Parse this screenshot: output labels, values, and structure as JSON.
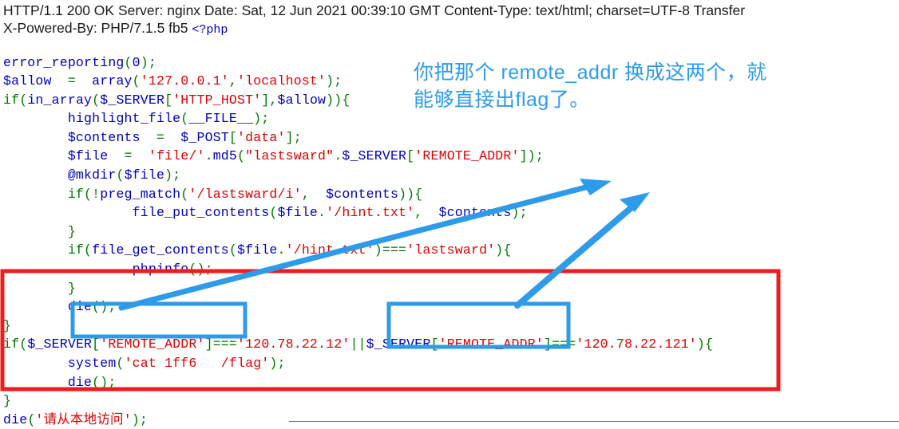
{
  "http_response": {
    "line1": "HTTP/1.1 200 OK Server: nginx Date: Sat, 12 Jun 2021 00:39:10 GMT Content-Type: text/html; charset=UTF-8 Transfer",
    "line2_prefix": "X-Powered-By: PHP/7.1.5 fb5 ",
    "php_open_tag": "<?php"
  },
  "code": {
    "lines": [
      [
        {
          "t": "error_reporting",
          "c": "fn"
        },
        {
          "t": "(",
          "c": "kw"
        },
        {
          "t": "0",
          "c": "fn"
        },
        {
          "t": ");",
          "c": "kw"
        }
      ],
      [
        {
          "t": "$allow",
          "c": "fn"
        },
        {
          "t": "  =  ",
          "c": "kw"
        },
        {
          "t": "array",
          "c": "fn"
        },
        {
          "t": "(",
          "c": "kw"
        },
        {
          "t": "'127.0.0.1'",
          "c": "str"
        },
        {
          "t": ",",
          "c": "kw"
        },
        {
          "t": "'localhost'",
          "c": "str"
        },
        {
          "t": ");",
          "c": "kw"
        }
      ],
      [
        {
          "t": "if",
          "c": "kw"
        },
        {
          "t": "(",
          "c": "kw"
        },
        {
          "t": "in_array",
          "c": "fn"
        },
        {
          "t": "(",
          "c": "kw"
        },
        {
          "t": "$_SERVER",
          "c": "fn"
        },
        {
          "t": "[",
          "c": "kw"
        },
        {
          "t": "'HTTP_HOST'",
          "c": "str"
        },
        {
          "t": "],",
          "c": "kw"
        },
        {
          "t": "$allow",
          "c": "fn"
        },
        {
          "t": ")){",
          "c": "kw"
        }
      ],
      [
        {
          "t": "        ",
          "c": "kw"
        },
        {
          "t": "highlight_file",
          "c": "fn"
        },
        {
          "t": "(",
          "c": "kw"
        },
        {
          "t": "__FILE__",
          "c": "fn"
        },
        {
          "t": ");",
          "c": "kw"
        }
      ],
      [
        {
          "t": "        ",
          "c": "kw"
        },
        {
          "t": "$contents",
          "c": "fn"
        },
        {
          "t": "  =  ",
          "c": "kw"
        },
        {
          "t": "$_POST",
          "c": "fn"
        },
        {
          "t": "[",
          "c": "kw"
        },
        {
          "t": "'data'",
          "c": "str"
        },
        {
          "t": "];",
          "c": "kw"
        }
      ],
      [
        {
          "t": "        ",
          "c": "kw"
        },
        {
          "t": "$file",
          "c": "fn"
        },
        {
          "t": "  =  ",
          "c": "kw"
        },
        {
          "t": "'file/'",
          "c": "str"
        },
        {
          "t": ".",
          "c": "kw"
        },
        {
          "t": "md5",
          "c": "fn"
        },
        {
          "t": "(",
          "c": "kw"
        },
        {
          "t": "\"lastsward\"",
          "c": "str"
        },
        {
          "t": ".",
          "c": "kw"
        },
        {
          "t": "$_SERVER",
          "c": "fn"
        },
        {
          "t": "[",
          "c": "kw"
        },
        {
          "t": "'REMOTE_ADDR'",
          "c": "str"
        },
        {
          "t": "]);",
          "c": "kw"
        }
      ],
      [
        {
          "t": "        ",
          "c": "kw"
        },
        {
          "t": "@mkdir",
          "c": "fn"
        },
        {
          "t": "(",
          "c": "kw"
        },
        {
          "t": "$file",
          "c": "fn"
        },
        {
          "t": ");",
          "c": "kw"
        }
      ],
      [
        {
          "t": "        ",
          "c": "kw"
        },
        {
          "t": "if",
          "c": "kw"
        },
        {
          "t": "(!",
          "c": "kw"
        },
        {
          "t": "preg_match",
          "c": "fn"
        },
        {
          "t": "(",
          "c": "kw"
        },
        {
          "t": "'/lastsward/i'",
          "c": "str"
        },
        {
          "t": ",  ",
          "c": "kw"
        },
        {
          "t": "$contents",
          "c": "fn"
        },
        {
          "t": ")){",
          "c": "kw"
        }
      ],
      [
        {
          "t": "                ",
          "c": "kw"
        },
        {
          "t": "file_put_contents",
          "c": "fn"
        },
        {
          "t": "(",
          "c": "kw"
        },
        {
          "t": "$file",
          "c": "fn"
        },
        {
          "t": ".",
          "c": "kw"
        },
        {
          "t": "'/hint.txt'",
          "c": "str"
        },
        {
          "t": ",  ",
          "c": "kw"
        },
        {
          "t": "$contents",
          "c": "fn"
        },
        {
          "t": ");",
          "c": "kw"
        }
      ],
      [
        {
          "t": "        }",
          "c": "kw"
        }
      ],
      [
        {
          "t": "        ",
          "c": "kw"
        },
        {
          "t": "if",
          "c": "kw"
        },
        {
          "t": "(",
          "c": "kw"
        },
        {
          "t": "file_get_contents",
          "c": "fn"
        },
        {
          "t": "(",
          "c": "kw"
        },
        {
          "t": "$file",
          "c": "fn"
        },
        {
          "t": ".",
          "c": "kw"
        },
        {
          "t": "'/hint.txt'",
          "c": "str"
        },
        {
          "t": ")===",
          "c": "kw"
        },
        {
          "t": "'lastsward'",
          "c": "str"
        },
        {
          "t": "){",
          "c": "kw"
        }
      ],
      [
        {
          "t": "                ",
          "c": "kw"
        },
        {
          "t": "phpinfo",
          "c": "fn"
        },
        {
          "t": "();",
          "c": "kw"
        }
      ],
      [
        {
          "t": "        }",
          "c": "kw"
        }
      ],
      [
        {
          "t": "        ",
          "c": "kw"
        },
        {
          "t": "die",
          "c": "fn"
        },
        {
          "t": "();",
          "c": "kw"
        }
      ],
      [
        {
          "t": "}",
          "c": "kw"
        }
      ],
      [
        {
          "t": "if",
          "c": "kw"
        },
        {
          "t": "(",
          "c": "kw"
        },
        {
          "t": "$_SERVER",
          "c": "fn"
        },
        {
          "t": "[",
          "c": "kw"
        },
        {
          "t": "'REMOTE_ADDR'",
          "c": "str"
        },
        {
          "t": "]===",
          "c": "kw"
        },
        {
          "t": "'120.78.22.12'",
          "c": "str"
        },
        {
          "t": "||",
          "c": "kw"
        },
        {
          "t": "$_SERVER",
          "c": "fn"
        },
        {
          "t": "[",
          "c": "kw"
        },
        {
          "t": "'REMOTE_ADDR'",
          "c": "str"
        },
        {
          "t": "]===",
          "c": "kw"
        },
        {
          "t": "'120.78.22.121'",
          "c": "str"
        },
        {
          "t": "){",
          "c": "kw"
        }
      ],
      [
        {
          "t": "        ",
          "c": "kw"
        },
        {
          "t": "system",
          "c": "fn"
        },
        {
          "t": "(",
          "c": "kw"
        },
        {
          "t": "'cat 1ff6   /flag'",
          "c": "str"
        },
        {
          "t": ");",
          "c": "kw"
        }
      ],
      [
        {
          "t": "        ",
          "c": "kw"
        },
        {
          "t": "die",
          "c": "fn"
        },
        {
          "t": "();",
          "c": "kw"
        }
      ],
      [
        {
          "t": "}",
          "c": "kw"
        }
      ],
      [
        {
          "t": "die",
          "c": "fn"
        },
        {
          "t": "(",
          "c": "kw"
        },
        {
          "t": "'请从本地访问'",
          "c": "str"
        },
        {
          "t": ");",
          "c": "kw"
        }
      ]
    ]
  },
  "annotation": {
    "line1": "你把那个 remote_addr 换成这两个，就",
    "line2": "能够直接出flag了。"
  },
  "colors": {
    "annotation_blue": "#2e9bea",
    "highlight_box_blue": "#2e9bea",
    "arrow_blue": "#2e9bea",
    "emphasis_box_red": "#ee1c1c",
    "php_keyword_green": "#007700",
    "php_function_blue": "#0000BB",
    "php_string_red": "#DD0000",
    "header_text": "#1a1a1a",
    "rule_gray": "#6f6f6f",
    "page_background": "#ffffff"
  },
  "markup": {
    "red_emphasis_box_label": "red-highlight-region",
    "blue_box_1_label": "first-remote-addr-highlight",
    "blue_box_2_label": "second-remote-addr-highlight",
    "arrow_1_label": "arrow-to-first-box",
    "arrow_2_label": "arrow-to-second-box"
  }
}
